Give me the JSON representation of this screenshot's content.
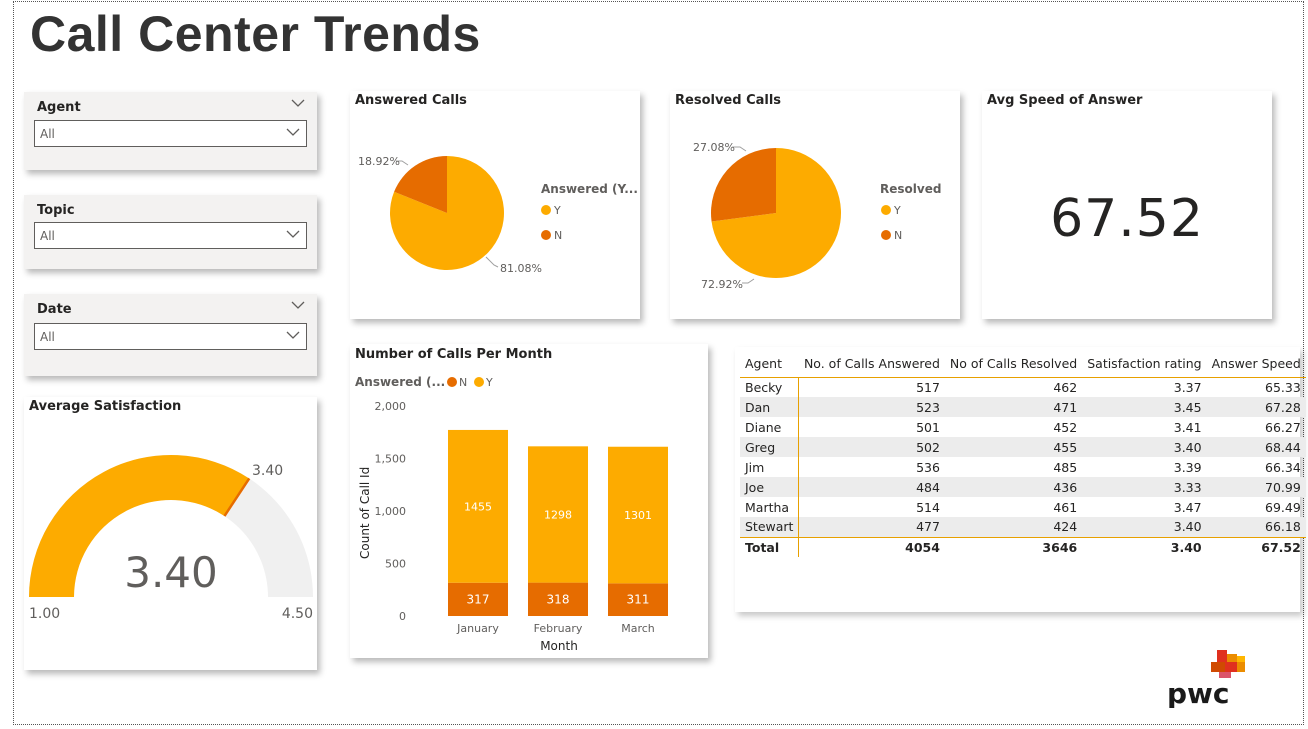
{
  "page": {
    "title": "Call Center Trends"
  },
  "slicers": [
    {
      "label": "Agent",
      "value": "All"
    },
    {
      "label": "Topic",
      "value": "All"
    },
    {
      "label": "Date",
      "value": "All"
    }
  ],
  "answered_calls": {
    "title": "Answered Calls",
    "legend_title": "Answered (Y...",
    "legend": [
      "Y",
      "N"
    ],
    "labels": {
      "y": "81.08%",
      "n": "18.92%"
    }
  },
  "resolved_calls": {
    "title": "Resolved Calls",
    "legend_title": "Resolved",
    "legend": [
      "Y",
      "N"
    ],
    "labels": {
      "y": "72.92%",
      "n": "27.08%"
    }
  },
  "kpi": {
    "title": "Avg Speed of Answer",
    "value": "67.52"
  },
  "gauge": {
    "title": "Average Satisfaction",
    "value_label": "3.40",
    "min_label": "1.00",
    "max_label": "4.50",
    "target_label": "3.40"
  },
  "monthly": {
    "title": "Number of Calls Per Month",
    "legend_title": "Answered (...",
    "legend": [
      "N",
      "Y"
    ],
    "xlabel": "Month",
    "ylabel": "Count of Call Id",
    "yticks": [
      "2,000",
      "1,500",
      "1,000",
      "500",
      "0"
    ]
  },
  "table": {
    "headers": [
      "Agent",
      "No. of Calls Answered",
      "No of Calls Resolved",
      "Satisfaction rating",
      "Answer Speed"
    ],
    "rows": [
      [
        "Becky",
        "517",
        "462",
        "3.37",
        "65.33"
      ],
      [
        "Dan",
        "523",
        "471",
        "3.45",
        "67.28"
      ],
      [
        "Diane",
        "501",
        "452",
        "3.41",
        "66.27"
      ],
      [
        "Greg",
        "502",
        "455",
        "3.40",
        "68.44"
      ],
      [
        "Jim",
        "536",
        "485",
        "3.39",
        "66.34"
      ],
      [
        "Joe",
        "484",
        "436",
        "3.33",
        "70.99"
      ],
      [
        "Martha",
        "514",
        "461",
        "3.47",
        "69.49"
      ],
      [
        "Stewart",
        "477",
        "424",
        "3.40",
        "66.18"
      ]
    ],
    "total": [
      "Total",
      "4054",
      "3646",
      "3.40",
      "67.52"
    ]
  },
  "logo": {
    "text": "pwc"
  },
  "colors": {
    "yes": "#fdab00",
    "no": "#e66c00",
    "gauge_track": "#f0f0f0",
    "panel": "#f3f2f1"
  },
  "chart_data": [
    {
      "type": "pie",
      "title": "Answered Calls",
      "categories": [
        "Y",
        "N"
      ],
      "values": [
        81.08,
        18.92
      ]
    },
    {
      "type": "pie",
      "title": "Resolved Calls",
      "categories": [
        "Y",
        "N"
      ],
      "values": [
        72.92,
        27.08
      ]
    },
    {
      "type": "bar",
      "stacked": true,
      "title": "Number of Calls Per Month",
      "categories": [
        "January",
        "February",
        "March"
      ],
      "series": [
        {
          "name": "N",
          "values": [
            317,
            318,
            311
          ]
        },
        {
          "name": "Y",
          "values": [
            1455,
            1298,
            1301
          ]
        }
      ],
      "xlabel": "Month",
      "ylabel": "Count of Call Id",
      "ylim": [
        0,
        2000
      ]
    },
    {
      "type": "gauge",
      "title": "Average Satisfaction",
      "min": 1.0,
      "max": 4.5,
      "value": 3.4,
      "target": 3.4
    }
  ]
}
